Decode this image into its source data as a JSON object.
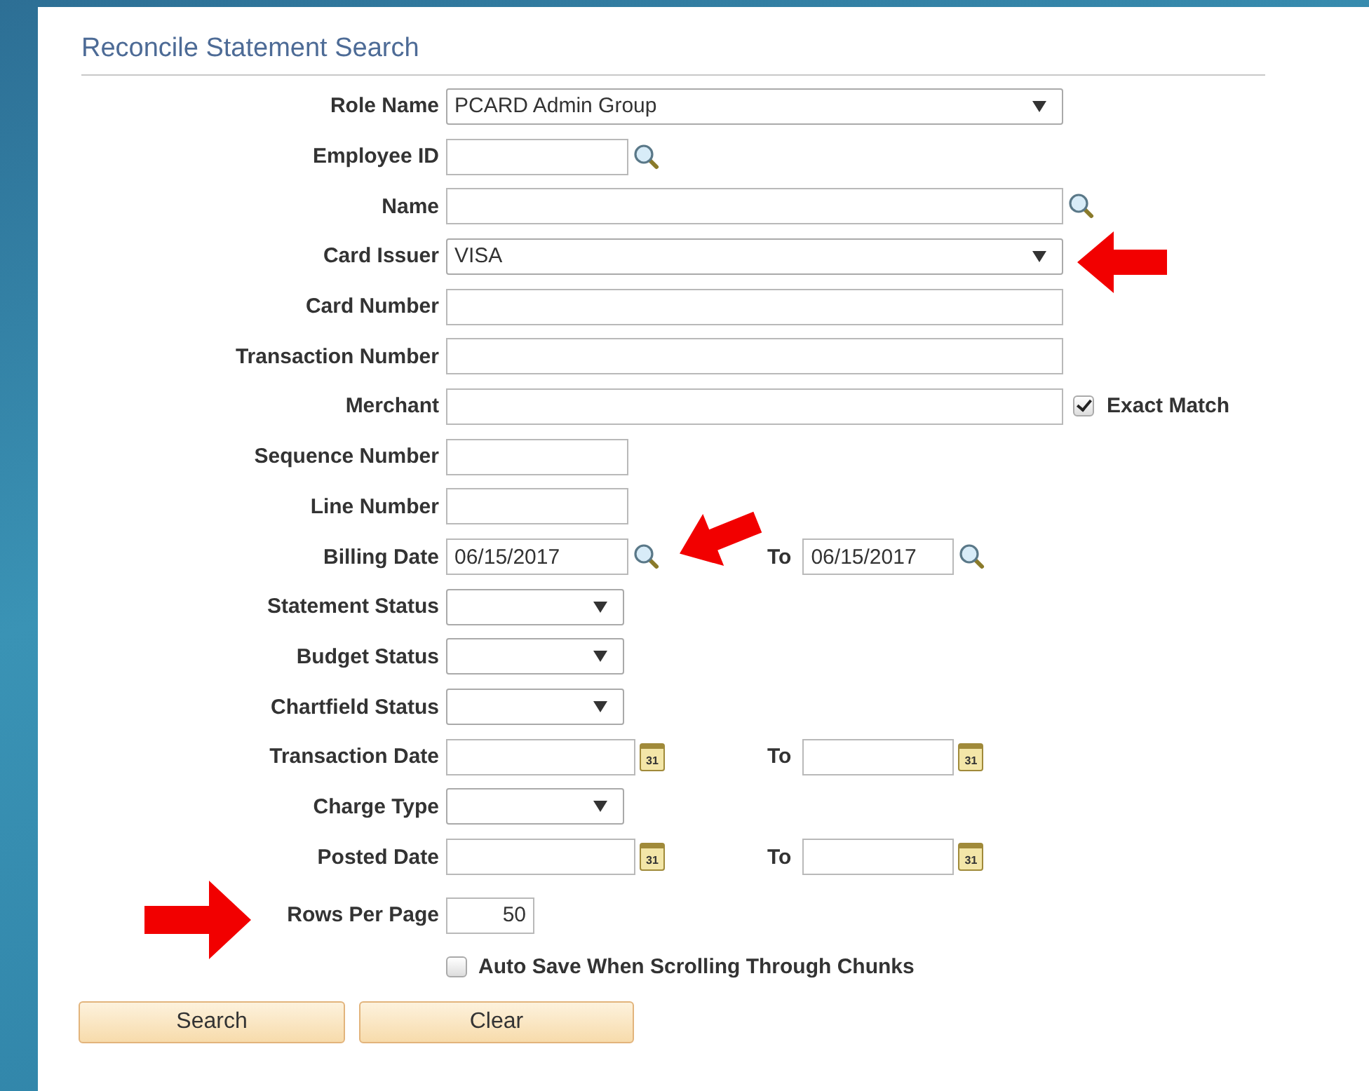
{
  "page_title": "Reconcile Statement Search",
  "fields": [
    {
      "label": "Role Name",
      "kind": "select-wide",
      "value": "PCARD Admin Group"
    },
    {
      "label": "Employee ID",
      "kind": "lookup-short"
    },
    {
      "label": "Name",
      "kind": "lookup-wide"
    },
    {
      "label": "Card Issuer",
      "kind": "select-wide",
      "value": "VISA"
    },
    {
      "label": "Card Number",
      "kind": "text-wide"
    },
    {
      "label": "Transaction Number",
      "kind": "text-wide"
    },
    {
      "label": "Merchant",
      "kind": "text-wide",
      "option": {
        "label": "Exact Match",
        "checked": true
      }
    },
    {
      "label": "Sequence Number",
      "kind": "text-short"
    },
    {
      "label": "Line Number",
      "kind": "text-short"
    },
    {
      "label": "Billing Date",
      "kind": "range-lookup",
      "value": "06/15/2017",
      "to_label": "To",
      "to_value": "06/15/2017"
    },
    {
      "label": "Statement Status",
      "kind": "select-short"
    },
    {
      "label": "Budget Status",
      "kind": "select-short"
    },
    {
      "label": "Chartfield Status",
      "kind": "select-short"
    },
    {
      "label": "Transaction Date",
      "kind": "range-calendar",
      "icon_text": "31",
      "to_label": "To",
      "to_icon_text": "31"
    },
    {
      "label": "Charge Type",
      "kind": "select-short"
    },
    {
      "label": "Posted Date",
      "kind": "range-calendar",
      "icon_text": "31",
      "to_label": "To",
      "to_icon_text": "31"
    },
    {
      "label": "Rows Per Page",
      "kind": "number",
      "value": "50"
    }
  ],
  "auto_save": {
    "label": "Auto Save When Scrolling Through Chunks",
    "checked": false
  },
  "buttons": [
    "Search",
    "Clear"
  ]
}
